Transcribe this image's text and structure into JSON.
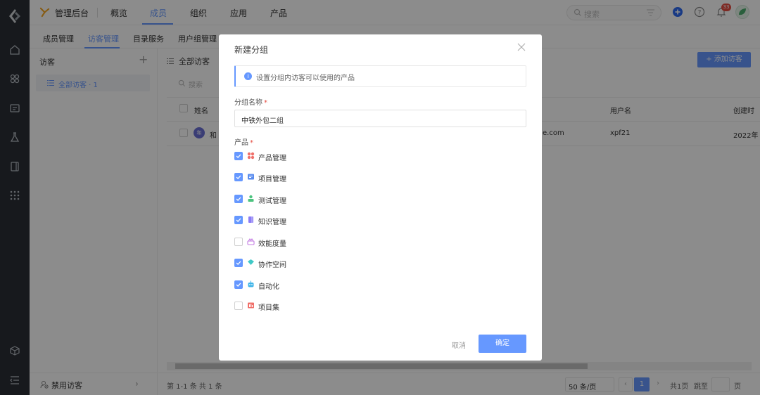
{
  "topbar": {
    "app_title": "管理后台",
    "nav": [
      "概览",
      "成员",
      "组织",
      "应用",
      "产品"
    ],
    "active_nav": "成员",
    "search_placeholder": "搜索",
    "notification_count": "33",
    "accent_color": "#6698ff"
  },
  "subtabs": {
    "items": [
      "成员管理",
      "访客管理",
      "目录服务",
      "用户组管理"
    ],
    "active": "访客管理"
  },
  "left_panel": {
    "title": "访客",
    "group_item": "全部访客 · 1",
    "footer": "禁用访客"
  },
  "main": {
    "title": "全部访客",
    "add_button": "+ 添加访客",
    "search_placeholder": "搜索",
    "columns": {
      "name": "姓名",
      "username": "用户名",
      "created": "创建时"
    },
    "row": {
      "avatar": "和",
      "name": "和",
      "email_suffix": "e.com",
      "username": "xpf21",
      "created": "2022年"
    },
    "pager": {
      "summary": "第 1-1 条  共 1 条",
      "page_size": "50 条/页",
      "current": "1",
      "total_pages": "共1页",
      "goto": "跳至",
      "page_unit": "页"
    }
  },
  "modal": {
    "title": "新建分组",
    "info": "设置分组内访客可以使用的产品",
    "group_name_label": "分组名称",
    "group_name_value": "中铁外包二组",
    "products_label": "产品",
    "products": [
      {
        "label": "产品管理",
        "checked": true,
        "icon": "product-icon",
        "color": "#f0706a"
      },
      {
        "label": "项目管理",
        "checked": true,
        "icon": "project-icon",
        "color": "#5b8def"
      },
      {
        "label": "测试管理",
        "checked": true,
        "icon": "test-icon",
        "color": "#4cc37f"
      },
      {
        "label": "知识管理",
        "checked": true,
        "icon": "wiki-icon",
        "color": "#8b7cf6"
      },
      {
        "label": "效能度量",
        "checked": false,
        "icon": "insight-icon",
        "color": "#c47de3"
      },
      {
        "label": "协作空间",
        "checked": true,
        "icon": "teams-icon",
        "color": "#3fc9c7"
      },
      {
        "label": "自动化",
        "checked": true,
        "icon": "robot-icon",
        "color": "#3fb4e8"
      },
      {
        "label": "项目集",
        "checked": false,
        "icon": "program-icon",
        "color": "#f0706a"
      }
    ],
    "cancel": "取消",
    "confirm": "确定"
  }
}
